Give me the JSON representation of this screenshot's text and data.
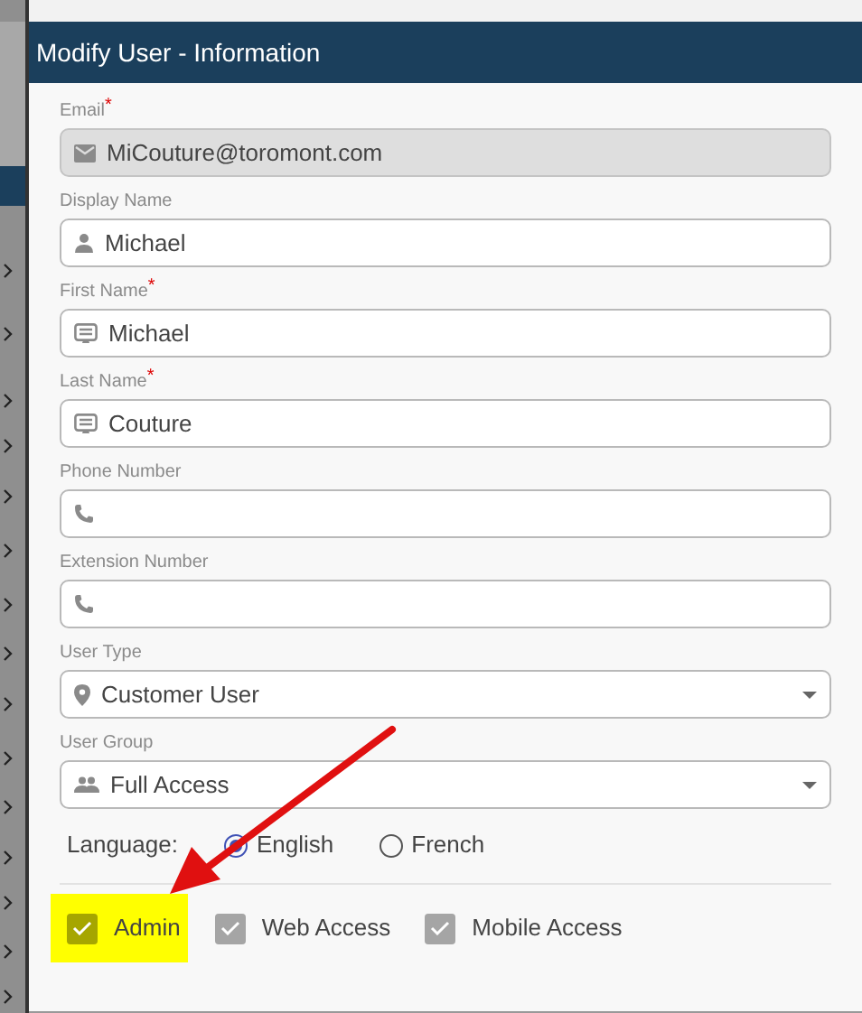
{
  "dialog": {
    "title": "Modify User - Information"
  },
  "fields": [
    {
      "label": "Email",
      "required_mark": "*",
      "kind": "email",
      "value": "MiCouture@toromont.com",
      "disabled": true,
      "dropdown": false
    },
    {
      "label": "Display Name",
      "kind": "person",
      "value": "Michael",
      "disabled": false,
      "dropdown": false
    },
    {
      "label": "First Name",
      "required_mark": "*",
      "kind": "name",
      "value": "Michael",
      "disabled": false,
      "dropdown": false
    },
    {
      "label": "Last Name",
      "required_mark": "*",
      "kind": "name",
      "value": "Couture",
      "disabled": false,
      "dropdown": false
    },
    {
      "label": "Phone Number",
      "kind": "phone",
      "disabled": false,
      "dropdown": false
    },
    {
      "label": "Extension Number",
      "kind": "phone",
      "disabled": false,
      "dropdown": false
    },
    {
      "label": "User Type",
      "kind": "location",
      "value": "Customer User",
      "disabled": false,
      "dropdown": true
    },
    {
      "label": "User Group",
      "kind": "group",
      "value": "Full Access",
      "disabled": false,
      "dropdown": true
    }
  ],
  "language": {
    "label": "Language:",
    "options": [
      {
        "label": "English",
        "selected": true
      },
      {
        "label": "French",
        "selected": false
      }
    ]
  },
  "checkboxes": [
    {
      "label": "Admin",
      "checked": true,
      "highlighted": true
    },
    {
      "label": "Web Access",
      "checked": true,
      "highlighted": false
    },
    {
      "label": "Mobile Access",
      "checked": true,
      "highlighted": false
    }
  ]
}
